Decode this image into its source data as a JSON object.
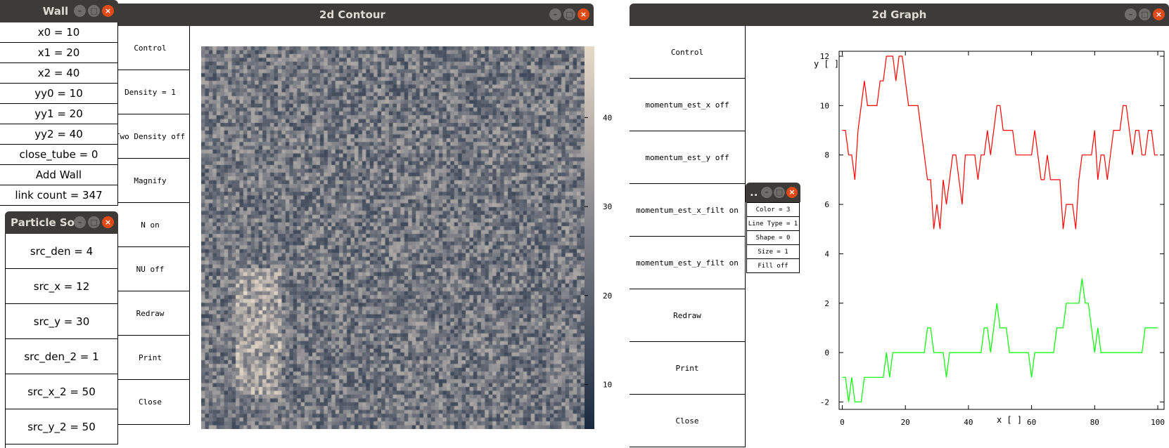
{
  "wall": {
    "title": "Wall",
    "items": [
      "x0 = 10",
      "x1 = 20",
      "x2 = 40",
      "yy0 = 10",
      "yy1 = 20",
      "yy2 = 40",
      "close_tube = 0",
      "Add Wall",
      "link count = 347"
    ]
  },
  "particle_source": {
    "title": "Particle So...",
    "items": [
      "src_den = 4",
      "src_x = 12",
      "src_y = 30",
      "src_den_2 = 1",
      "src_x_2 = 50",
      "src_y_2 = 50"
    ]
  },
  "contour": {
    "title": "2d Contour",
    "buttons": [
      "Control",
      "Density = 1",
      "Two Density  off",
      "Magnify",
      "N on",
      "NU off",
      "Redraw",
      "Print",
      "Close"
    ],
    "colorbar_ticks": [
      40,
      30,
      20,
      10
    ],
    "colorbar_range": [
      5,
      48
    ],
    "colors": {
      "low": "#1a2a40",
      "mid": "#7c7e86",
      "high": "#e8dac8"
    }
  },
  "graph": {
    "title": "2d Graph",
    "buttons": [
      "Control",
      "momentum_est_x off",
      "momentum_est_y off",
      "momentum_est_x_filt on",
      "momentum_est_y_filt on",
      "Redraw",
      "Print",
      "Close"
    ]
  },
  "style_popup": {
    "title": "..",
    "items": [
      "Color = 3",
      "Line Type = 1",
      "Shape = 0",
      "Size = 1",
      "Fill off"
    ]
  },
  "chart_data": {
    "type": "line",
    "xlabel": "x [ ]",
    "ylabel": "y [ ]",
    "xlim": [
      -1,
      102
    ],
    "ylim": [
      -2.3,
      12.2
    ],
    "xticks": [
      0,
      20,
      40,
      60,
      80,
      100
    ],
    "yticks": [
      -2,
      0,
      2,
      4,
      6,
      8,
      10,
      12
    ],
    "series": [
      {
        "color": "#ff0000",
        "x": [
          0,
          1,
          2,
          3,
          4,
          5,
          6,
          7,
          8,
          9,
          10,
          11,
          12,
          13,
          14,
          15,
          16,
          17,
          18,
          19,
          20,
          21,
          22,
          23,
          24,
          25,
          26,
          27,
          28,
          29,
          30,
          31,
          32,
          33,
          34,
          35,
          36,
          37,
          38,
          39,
          40,
          41,
          42,
          43,
          44,
          45,
          46,
          47,
          48,
          49,
          50,
          51,
          52,
          53,
          54,
          55,
          56,
          57,
          58,
          59,
          60,
          61,
          62,
          63,
          64,
          65,
          66,
          67,
          68,
          69,
          70,
          71,
          72,
          73,
          74,
          75,
          76,
          77,
          78,
          79,
          80,
          81,
          82,
          83,
          84,
          85,
          86,
          87,
          88,
          89,
          90,
          91,
          92,
          93,
          94,
          95,
          96,
          97,
          98,
          99,
          100
        ],
        "values": [
          9,
          9,
          8,
          8,
          7,
          9,
          10,
          11,
          10,
          10,
          10,
          10,
          11,
          11,
          12,
          12,
          12,
          11,
          12,
          12,
          11,
          10,
          10,
          10,
          10,
          9,
          8,
          7,
          7,
          5,
          6,
          5,
          7,
          6,
          7,
          8,
          8,
          7,
          6,
          8,
          8,
          8,
          8,
          7,
          8,
          8,
          9,
          8,
          9,
          10,
          10,
          9,
          9,
          9,
          9,
          8,
          8,
          8,
          8,
          8,
          8,
          9,
          8,
          7,
          7,
          8,
          7,
          7,
          7,
          7,
          5,
          6,
          6,
          6,
          5,
          7,
          8,
          8,
          8,
          8,
          9,
          7,
          8,
          8,
          7,
          8,
          9,
          9,
          9,
          10,
          10,
          9,
          8,
          9,
          9,
          8,
          8,
          9,
          9,
          8,
          8
        ]
      },
      {
        "color": "#00ff00",
        "x": [
          0,
          1,
          2,
          3,
          4,
          5,
          6,
          7,
          8,
          9,
          10,
          11,
          12,
          13,
          14,
          15,
          16,
          17,
          18,
          19,
          20,
          21,
          22,
          23,
          24,
          25,
          26,
          27,
          28,
          29,
          30,
          31,
          32,
          33,
          34,
          35,
          36,
          37,
          38,
          39,
          40,
          41,
          42,
          43,
          44,
          45,
          46,
          47,
          48,
          49,
          50,
          51,
          52,
          53,
          54,
          55,
          56,
          57,
          58,
          59,
          60,
          61,
          62,
          63,
          64,
          65,
          66,
          67,
          68,
          69,
          70,
          71,
          72,
          73,
          74,
          75,
          76,
          77,
          78,
          79,
          80,
          81,
          82,
          83,
          84,
          85,
          86,
          87,
          88,
          89,
          90,
          91,
          92,
          93,
          94,
          95,
          96,
          97,
          98,
          99,
          100
        ],
        "values": [
          -1,
          -1,
          -2,
          -1,
          -2,
          -2,
          -2,
          -1,
          -1,
          -1,
          -1,
          -1,
          -1,
          -1,
          0,
          -1,
          0,
          0,
          0,
          0,
          0,
          0,
          0,
          0,
          0,
          0,
          0,
          1,
          1,
          0,
          0,
          0,
          0,
          -1,
          0,
          0,
          0,
          0,
          0,
          0,
          0,
          0,
          0,
          0,
          0,
          1,
          1,
          0,
          1,
          2,
          1,
          1,
          1,
          0,
          0,
          0,
          0,
          0,
          0,
          0,
          -1,
          0,
          0,
          0,
          0,
          0,
          0,
          0,
          1,
          1,
          1,
          2,
          2,
          2,
          2,
          2,
          3,
          2,
          2,
          1,
          0,
          1,
          0,
          0,
          0,
          0,
          0,
          0,
          0,
          0,
          0,
          0,
          0,
          0,
          0,
          0,
          1,
          1,
          1,
          1,
          1
        ]
      }
    ]
  }
}
